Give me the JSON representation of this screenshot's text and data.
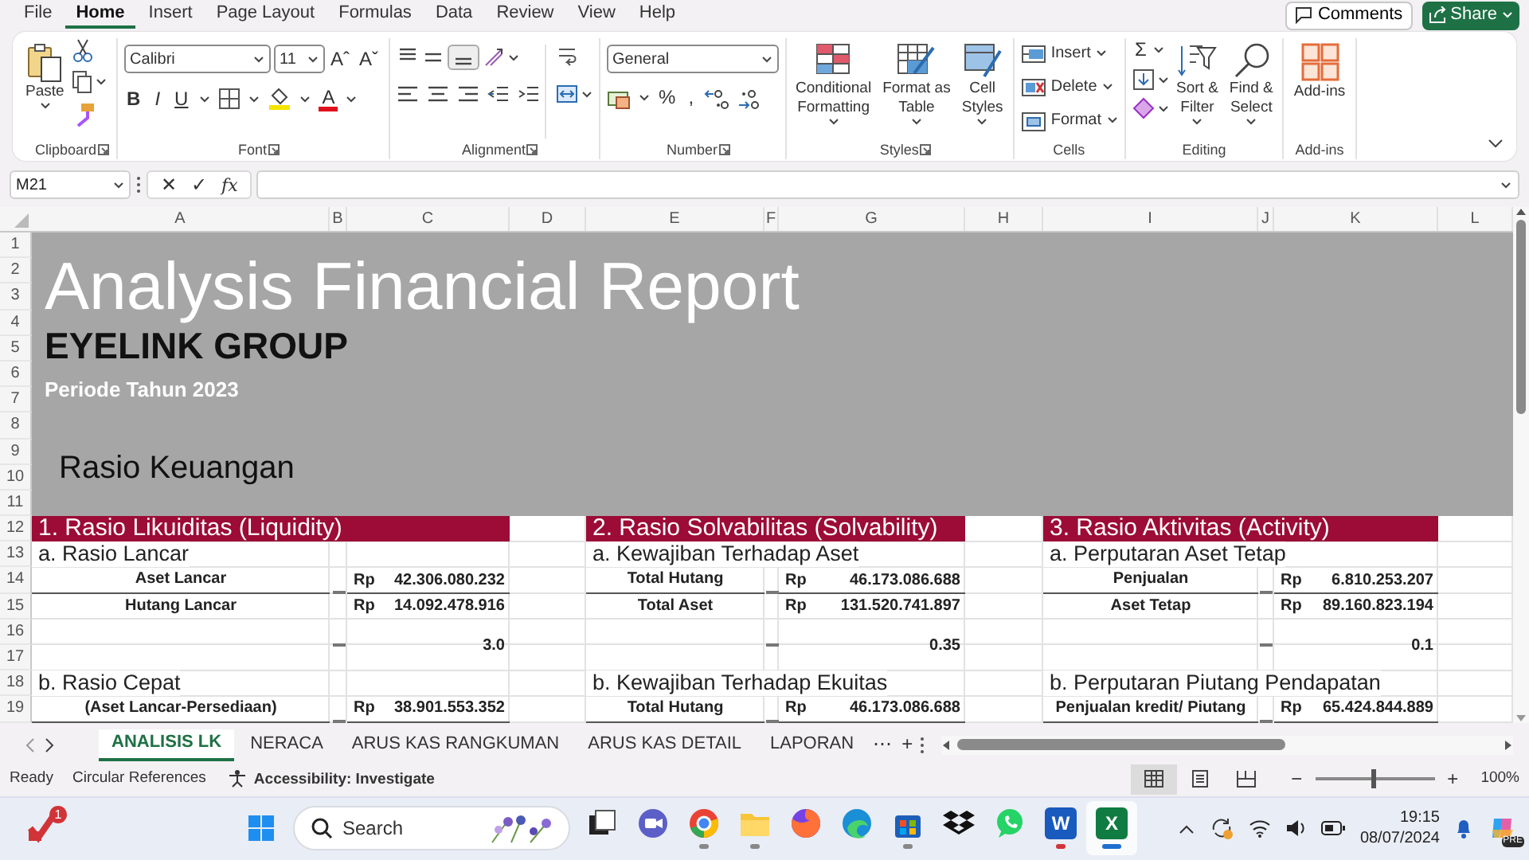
{
  "menu_tabs": [
    {
      "label": "File",
      "selected": false
    },
    {
      "label": "Home",
      "selected": true
    },
    {
      "label": "Insert",
      "selected": false
    },
    {
      "label": "Page Layout",
      "selected": false
    },
    {
      "label": "Formulas",
      "selected": false
    },
    {
      "label": "Data",
      "selected": false
    },
    {
      "label": "Review",
      "selected": false
    },
    {
      "label": "View",
      "selected": false
    },
    {
      "label": "Help",
      "selected": false
    }
  ],
  "comments_button": "Comments",
  "share_button": "Share",
  "ribbon": {
    "clipboard": {
      "paste": "Paste",
      "label": "Clipboard"
    },
    "font": {
      "name": "Calibri",
      "size": "11",
      "grow": "Aˆ",
      "shrink": "Aˇ",
      "bold": "B",
      "italic": "I",
      "underline": "U",
      "color_letter": "A",
      "label": "Font"
    },
    "alignment": {
      "label": "Alignment"
    },
    "number": {
      "format": "General",
      "percent": "%",
      "comma": ",",
      "label": "Number"
    },
    "styles": {
      "buttons": [
        {
          "kind": "conditional",
          "lines": [
            "Conditional",
            "Formatting"
          ]
        },
        {
          "kind": "table",
          "lines": [
            "Format as",
            "Table"
          ]
        },
        {
          "kind": "cell",
          "lines": [
            "Cell",
            "Styles"
          ]
        }
      ],
      "label": "Styles"
    },
    "cells": {
      "buttons": [
        {
          "kind": "insert",
          "label": "Insert"
        },
        {
          "kind": "delete",
          "label": "Delete"
        },
        {
          "kind": "format",
          "label": "Format"
        }
      ],
      "label": "Cells"
    },
    "editing": {
      "sum": "Σ",
      "sort": [
        "Sort &",
        "Filter"
      ],
      "find": [
        "Find &",
        "Select"
      ],
      "label": "Editing"
    },
    "addins": {
      "button": "Add-ins",
      "label": "Add-ins"
    }
  },
  "formula_bar": {
    "name_box": "M21",
    "cancel": "✕",
    "enter": "✓",
    "fx": "fx"
  },
  "columns": [
    "A",
    "B",
    "C",
    "D",
    "E",
    "F",
    "G",
    "H",
    "I",
    "J",
    "K",
    "L"
  ],
  "rows": [
    "1",
    "2",
    "3",
    "4",
    "5",
    "6",
    "7",
    "8",
    "9",
    "10",
    "11",
    "12",
    "13",
    "14",
    "15",
    "16",
    "17",
    "18",
    "19"
  ],
  "report": {
    "title": "Analysis Financial Report",
    "company": "EYELINK GROUP",
    "period": "Periode Tahun 2023",
    "subtitle": "Rasio Keuangan"
  },
  "sections": [
    {
      "header": "1. Rasio Likuiditas (Liquidity)",
      "blocks": [
        {
          "title": "a. Rasio Lancar",
          "lines": [
            {
              "label": "Aset Lancar",
              "currency": "Rp",
              "value": "42.306.080.232"
            },
            {
              "label": "Hutang Lancar",
              "currency": "Rp",
              "value": "14.092.478.916"
            }
          ],
          "result": "3.0"
        },
        {
          "title": "b. Rasio Cepat",
          "lines": [
            {
              "label": "(Aset Lancar-Persediaan)",
              "currency": "Rp",
              "value": "38.901.553.352"
            }
          ]
        }
      ]
    },
    {
      "header": "2. Rasio Solvabilitas (Solvability)",
      "blocks": [
        {
          "title": "a. Kewajiban Terhadap Aset",
          "lines": [
            {
              "label": "Total Hutang",
              "currency": "Rp",
              "value": "46.173.086.688"
            },
            {
              "label": "Total Aset",
              "currency": "Rp",
              "value": "131.520.741.897"
            }
          ],
          "result": "0.35"
        },
        {
          "title": "b. Kewajiban Terhadap Ekuitas",
          "lines": [
            {
              "label": "Total Hutang",
              "currency": "Rp",
              "value": "46.173.086.688"
            }
          ]
        }
      ]
    },
    {
      "header": "3. Rasio Aktivitas (Activity)",
      "blocks": [
        {
          "title": "a. Perputaran Aset Tetap",
          "lines": [
            {
              "label": "Penjualan",
              "currency": "Rp",
              "value": "6.810.253.207"
            },
            {
              "label": "Aset Tetap",
              "currency": "Rp",
              "value": "89.160.823.194"
            }
          ],
          "result": "0.1"
        },
        {
          "title": "b. Perputaran Piutang Pendapatan",
          "lines": [
            {
              "label": "Penjualan kredit/ Piutang",
              "currency": "Rp",
              "value": "65.424.844.889"
            }
          ]
        }
      ]
    }
  ],
  "sheet_tabs": [
    {
      "label": "ANALISIS LK",
      "selected": true
    },
    {
      "label": "NERACA",
      "selected": false
    },
    {
      "label": "ARUS KAS RANGKUMAN",
      "selected": false
    },
    {
      "label": "ARUS KAS DETAIL",
      "selected": false
    },
    {
      "label": "LAPORAN",
      "selected": false
    }
  ],
  "more_tabs": "⋯",
  "add_sheet": "+",
  "status_bar": {
    "mode": "Ready",
    "circular": "Circular References",
    "accessibility": "Accessibility: Investigate",
    "views": [
      {
        "kind": "normal",
        "selected": true
      },
      {
        "kind": "layout",
        "selected": false
      },
      {
        "kind": "break",
        "selected": false
      }
    ],
    "zoom_minus": "−",
    "zoom_plus": "+",
    "zoom_slider": {
      "level": 0.48
    },
    "zoom_text": "100%"
  },
  "taskbar": {
    "notification_count": "1",
    "search": "Search",
    "apps": [
      {
        "kind": "task-view",
        "running": false,
        "selected": false
      },
      {
        "kind": "video-call",
        "running": false,
        "selected": false
      },
      {
        "kind": "round-browser",
        "running": true,
        "selected": false
      },
      {
        "kind": "folder",
        "running": true,
        "selected": false
      },
      {
        "kind": "fox-browser",
        "running": false,
        "selected": false
      },
      {
        "kind": "wave-browser",
        "running": false,
        "selected": false
      },
      {
        "kind": "store",
        "running": true,
        "selected": false
      },
      {
        "kind": "boxes",
        "running": false,
        "selected": false
      },
      {
        "kind": "chat",
        "running": false,
        "selected": false
      },
      {
        "kind": "document",
        "label": "W",
        "running": true,
        "selected": false
      },
      {
        "kind": "spreadsheet",
        "label": "X",
        "running": true,
        "selected": true
      }
    ],
    "time": "19:15",
    "date": "08/07/2024",
    "copilot_badge": "PRE"
  }
}
